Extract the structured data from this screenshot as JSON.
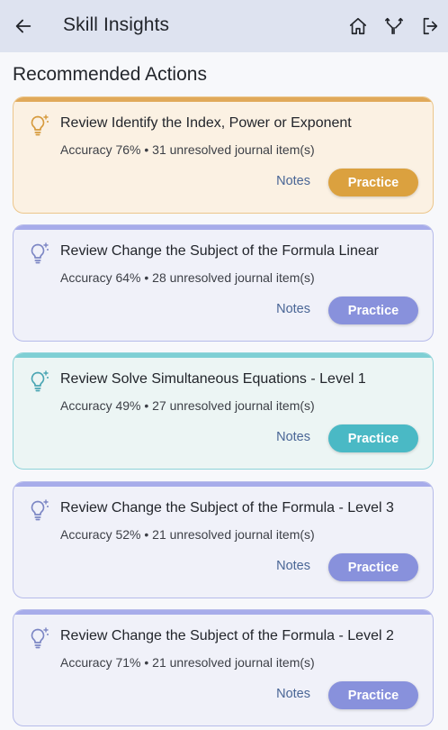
{
  "appbar": {
    "title": "Skill Insights",
    "back_icon": "arrow-left-icon",
    "actions": [
      "home-icon",
      "fork-icon",
      "logout-icon"
    ]
  },
  "section": {
    "title": "Recommended Actions"
  },
  "colors": {
    "appbar_bg": "#dee3f0",
    "orange": "#dba13f",
    "purple": "#8891dc",
    "teal": "#4ab9c5"
  },
  "cards": [
    {
      "title": "Review Identify the Index, Power or Exponent",
      "meta": "Accuracy 76% • 31 unresolved journal item(s)",
      "notes_label": "Notes",
      "practice_label": "Practice",
      "theme": "orange"
    },
    {
      "title": "Review Change the Subject of the Formula Linear",
      "meta": "Accuracy 64% • 28 unresolved journal item(s)",
      "notes_label": "Notes",
      "practice_label": "Practice",
      "theme": "purple"
    },
    {
      "title": "Review Solve Simultaneous Equations - Level 1",
      "meta": "Accuracy 49% • 27 unresolved journal item(s)",
      "notes_label": "Notes",
      "practice_label": "Practice",
      "theme": "teal"
    },
    {
      "title": "Review Change the Subject of the Formula - Level 3",
      "meta": "Accuracy 52% • 21 unresolved journal item(s)",
      "notes_label": "Notes",
      "practice_label": "Practice",
      "theme": "purple"
    },
    {
      "title": "Review Change the Subject of the Formula - Level 2",
      "meta": "Accuracy 71% • 21 unresolved journal item(s)",
      "notes_label": "Notes",
      "practice_label": "Practice",
      "theme": "purple"
    }
  ]
}
